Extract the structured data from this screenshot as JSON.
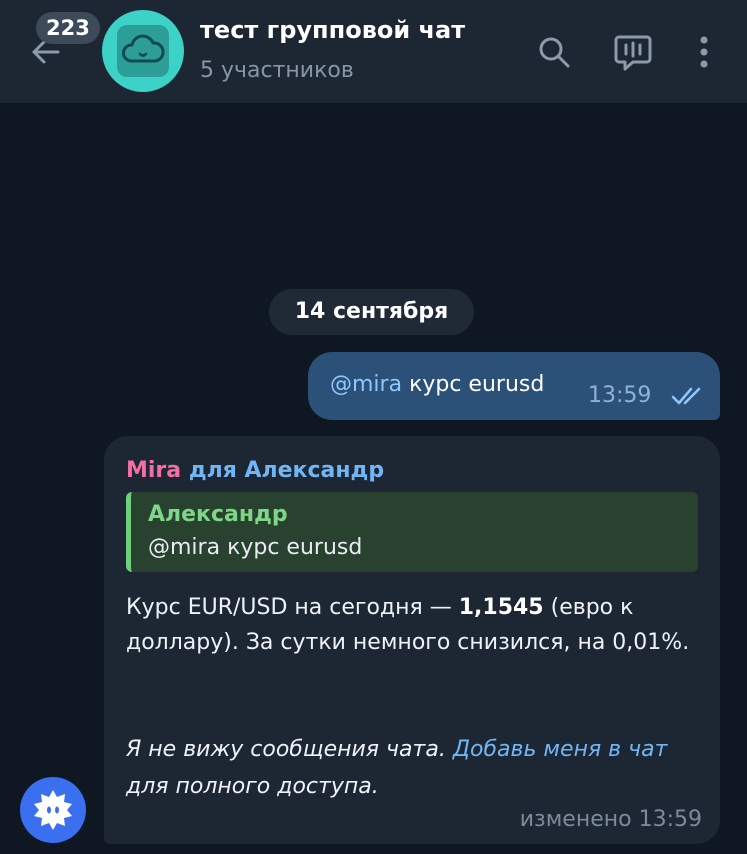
{
  "header": {
    "unread_count": "223",
    "chat_title": "тест групповой чат",
    "chat_subtitle": "5 участников",
    "icons": [
      "back-arrow-icon",
      "cloud-avatar-icon",
      "search-icon",
      "voice-chat-icon",
      "more-vertical-icon"
    ]
  },
  "date_separator": "14 сентября",
  "outgoing_message": {
    "mention": "@mira",
    "text": " курс eurusd",
    "time": "13:59",
    "status_icon": "double-check-icon"
  },
  "incoming_message": {
    "sender": "Mira",
    "for_label": "для Александр",
    "reply": {
      "name": "Александр",
      "text": "@mira курс eurusd"
    },
    "body_prefix": "Курс EUR/USD на сегодня — ",
    "body_value": "1,1545",
    "body_suffix": " (евро к доллару). За сутки немного снизился, на 0,01%.",
    "note_prefix": "Я не вижу сообщения чата. ",
    "note_link": "Добавь меня в чат",
    "note_suffix": " для полного доступа.",
    "edited_label": "изменено",
    "time": "13:59"
  },
  "colors": {
    "background": "#0f1722",
    "header": "#1c2733",
    "outgoing_bubble": "#2b5178",
    "incoming_bubble": "#1c2733",
    "avatar": "#3cd2c8",
    "sender": "#f16fa3",
    "link": "#72b5f5",
    "reply_accent": "#6fd07b"
  }
}
